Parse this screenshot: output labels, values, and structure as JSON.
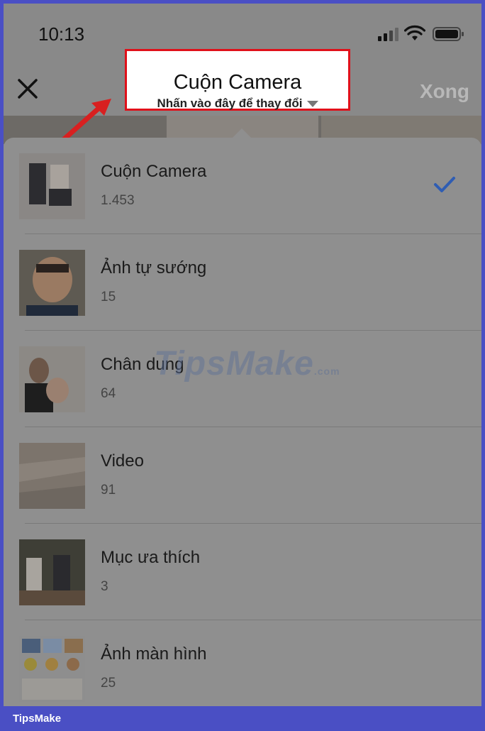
{
  "status": {
    "time": "10:13"
  },
  "nav": {
    "title": "Cuộn Camera",
    "subtitle": "Nhấn vào đây để thay đổi",
    "done_label": "Xong"
  },
  "albums": [
    {
      "name": "Cuộn Camera",
      "count": "1.453",
      "selected": true
    },
    {
      "name": "Ảnh tự sướng",
      "count": "15",
      "selected": false
    },
    {
      "name": "Chân dung",
      "count": "64",
      "selected": false
    },
    {
      "name": "Video",
      "count": "91",
      "selected": false
    },
    {
      "name": "Mục ưa thích",
      "count": "3",
      "selected": false
    },
    {
      "name": "Ảnh màn hình",
      "count": "25",
      "selected": false
    }
  ],
  "watermark": {
    "text": "TipsMake",
    "suffix": ".com"
  },
  "footer": {
    "brand": "TipsMake"
  },
  "colors": {
    "highlight": "#e0101a",
    "check": "#2f5db3",
    "frame": "#4a4fc4"
  }
}
